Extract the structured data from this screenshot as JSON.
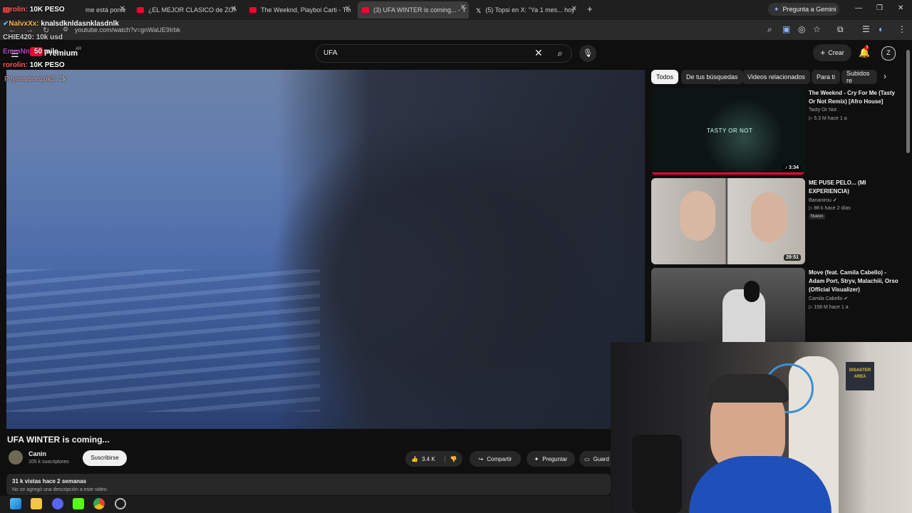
{
  "browser": {
    "tabs": [
      {
        "label": "me está poniendo",
        "favicon_color": "#e53935"
      },
      {
        "label": "¿EL MEJOR CLASICO de ZONA",
        "favicon_color": "#ff0033"
      },
      {
        "label": "The Weeknd, Playboi Carti - Tim",
        "favicon_color": "#ff0033"
      },
      {
        "label": "(3) UFA WINTER is coming... - Y",
        "favicon_color": "#ff0033"
      },
      {
        "label": "(5) Topsi en X: \"Ya 1 mes... hoy",
        "favicon_color": "#ffffff"
      }
    ],
    "new_tab": "+",
    "gemini_label": "Pregunta a Gemini",
    "url": "youtube.com/watch?v=gnWaUE9Irbk"
  },
  "youtube": {
    "logo_text": "Premium",
    "country": "AR",
    "search_value": "UFA",
    "create_label": "Crear",
    "notification_count": "3",
    "chips": [
      "Todos",
      "De tus búsquedas",
      "Videos relacionados",
      "Para ti",
      "Subidos re"
    ],
    "video": {
      "title": "UFA WINTER is coming...",
      "channel": "Canin",
      "subscribers": "105 k suscriptores",
      "subscribe_label": "Suscribirse",
      "likes": "3.4 K",
      "share_label": "Compartir",
      "ask_label": "Preguntar",
      "save_label": "Guard",
      "views": "31 k vistas  hace 2 semanas",
      "description": "No se agregó una descripción a este video."
    },
    "recommendations": [
      {
        "title": "The Weeknd - Cry For Me (Tasty Or Not Remix) [Afro House]",
        "channel": "Tasty Or Not",
        "meta": "▷ 5.3 M  hace 1 a",
        "duration": "♪ 3:34",
        "thumb_text": "TASTY OR NOT"
      },
      {
        "title": "ME PUSE PELO... (MI EXPERIENCIA)",
        "channel": "Bananirou",
        "meta": "▷ 86 k  hace 2 días",
        "duration": "29:51",
        "badge": "Nuevo"
      },
      {
        "title": "Move (feat. Camila Cabello) - Adam Port, Stryv, Malachiii, Orso (Official Visualizer)",
        "channel": "Camila Cabello",
        "meta": "▷ 158 M  hace 1 a",
        "duration": ""
      }
    ]
  },
  "chat": [
    {
      "user": "rorolin:",
      "text": "10K PESO",
      "color": "#ff5a5a"
    },
    {
      "user": "NalvxXx:",
      "text": "knalsdknldasnklasdnlk",
      "color": "#ffb74d"
    },
    {
      "user": "CHIE420:",
      "text": "10k usd",
      "color": "#dddddd"
    },
    {
      "user": "EmmNn:",
      "text": "50 mile",
      "color": "#ab47bc"
    },
    {
      "user": "rorolin:",
      "text": "10K PESO",
      "color": "#ff5a5a"
    },
    {
      "user": "Pitymartinezok3:",
      "text": "2k",
      "color": "#d8a0a0"
    }
  ],
  "webcam": {
    "poster_text": "DISASTER AREA"
  }
}
